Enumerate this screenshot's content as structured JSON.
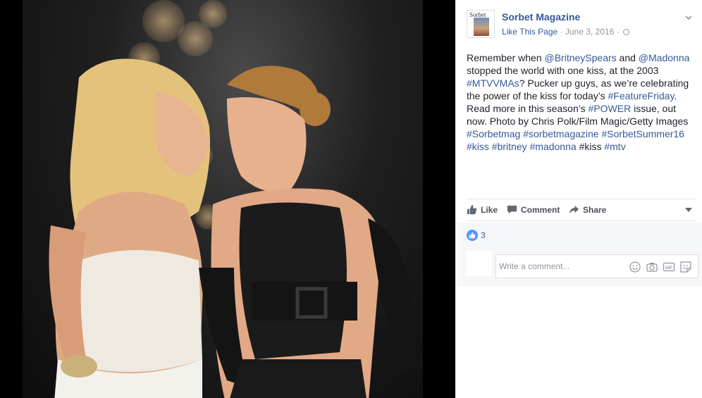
{
  "post": {
    "page_name": "Sorbet Magazine",
    "like_page": "Like This Page",
    "separator": " · ",
    "date": "June 3, 2016",
    "date_separator": " · ",
    "avatar_masthead": "Sorbet"
  },
  "text": {
    "line1_a": "Remember when ",
    "mention1": "@BritneySpears",
    "line1_b": " and ",
    "mention2": "@Madonna",
    "line2": " stopped the world with one kiss, at the 2003 ",
    "ht_mtvvmas": "#MTVVMAs",
    "line3": "? Pucker up guys, as we’re celebrating the power of the kiss for today’s ",
    "ht_featurefriday": "#FeatureFriday",
    "line4": ". Read more in this season’s ",
    "ht_power": "#POWER",
    "line5": " issue, out now. Photo by Chris Polk/Film Magic/Getty Images ",
    "ht_sorbetmag": "#Sorbetmag",
    "ht_sorbetmagazine": "#sorbetmagazine",
    "ht_sorbetsummer16": "#SorbetSummer16",
    "ht_kiss": "#kiss",
    "ht_britney": "#britney",
    "ht_madonna": "#madonna",
    "plain_kiss": "#kiss",
    "ht_mtv": "#mtv"
  },
  "actions": {
    "like": "Like",
    "comment": "Comment",
    "share": "Share"
  },
  "reactions": {
    "like_count": "3"
  },
  "comment": {
    "placeholder": "Write a comment..."
  },
  "colors": {
    "link": "#365899",
    "like_badge": "#5890ff",
    "panel_bg": "#f6f7f9"
  },
  "icons": [
    "chevron-down-icon",
    "globe-icon",
    "thumbs-up-icon",
    "comment-icon",
    "share-icon",
    "emoji-icon",
    "camera-icon",
    "gif-icon",
    "sticker-icon"
  ]
}
